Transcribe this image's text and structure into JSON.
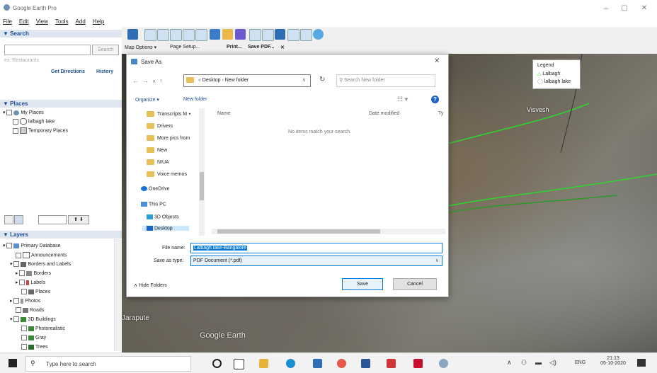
{
  "window": {
    "title": "Google Earth Pro",
    "controls": [
      "–",
      "▢",
      "✕"
    ]
  },
  "menu": [
    "File",
    "Edit",
    "View",
    "Tools",
    "Add",
    "Help"
  ],
  "search": {
    "header": "▼ Search",
    "button": "Search",
    "placeholder": "ex: Restaurants",
    "get_directions": "Get Directions",
    "history": "History"
  },
  "places": {
    "header": "▼ Places",
    "items": [
      "My Places",
      "lalbagh lake",
      "Temporary Places"
    ]
  },
  "layers": {
    "header": "▼ Layers",
    "items": [
      "Primary Database",
      "Announcements",
      "Borders and Labels",
      "Borders",
      "Labels",
      "Places",
      "Photos",
      "Roads",
      "3D Buildings",
      "Photorealistic",
      "Gray",
      "Trees"
    ]
  },
  "printbar": {
    "map_options": "Map Options ▾",
    "page_setup": "Page Setup...",
    "print": "Print...",
    "save_pdf": "Save PDF...",
    "close": "✕"
  },
  "legend": {
    "title": "Legend",
    "items": [
      "Lalbagh",
      "lalbagh lake"
    ]
  },
  "map": {
    "place_label": "Visvesh",
    "area_label": "Jarapute",
    "watermark": "Google Earth"
  },
  "dialog": {
    "title": "Save As",
    "close": "✕",
    "path": [
      "Desktop",
      "New folder"
    ],
    "search_placeholder": "Search New folder",
    "organize": "Organize ▾",
    "new_folder": "New folder",
    "col_name": "Name",
    "col_date": "Date modified",
    "col_type": "Ty",
    "empty_msg": "No items match your search.",
    "nav_items": [
      "Transcripts M ⭑",
      "Drivers",
      "More pics from",
      "New",
      "NIUA",
      "Voice memos",
      "OneDrive",
      "This PC",
      "3D Objects",
      "Desktop"
    ],
    "filename_label": "File name:",
    "filename_value": "Lalbagh lake-Bangalore",
    "savetype_label": "Save as type:",
    "savetype_value": "PDF Document (*.pdf)",
    "hide_folders": "Hide Folders",
    "save": "Save",
    "cancel": "Cancel"
  },
  "taskbar": {
    "search_placeholder": "Type here to search",
    "lang": "ENG",
    "time": "21:13",
    "date": "05-10-2020"
  },
  "colors": {
    "accent": "#1e4e95",
    "selection": "#cce8ff",
    "map_line": "#2cd62c"
  }
}
